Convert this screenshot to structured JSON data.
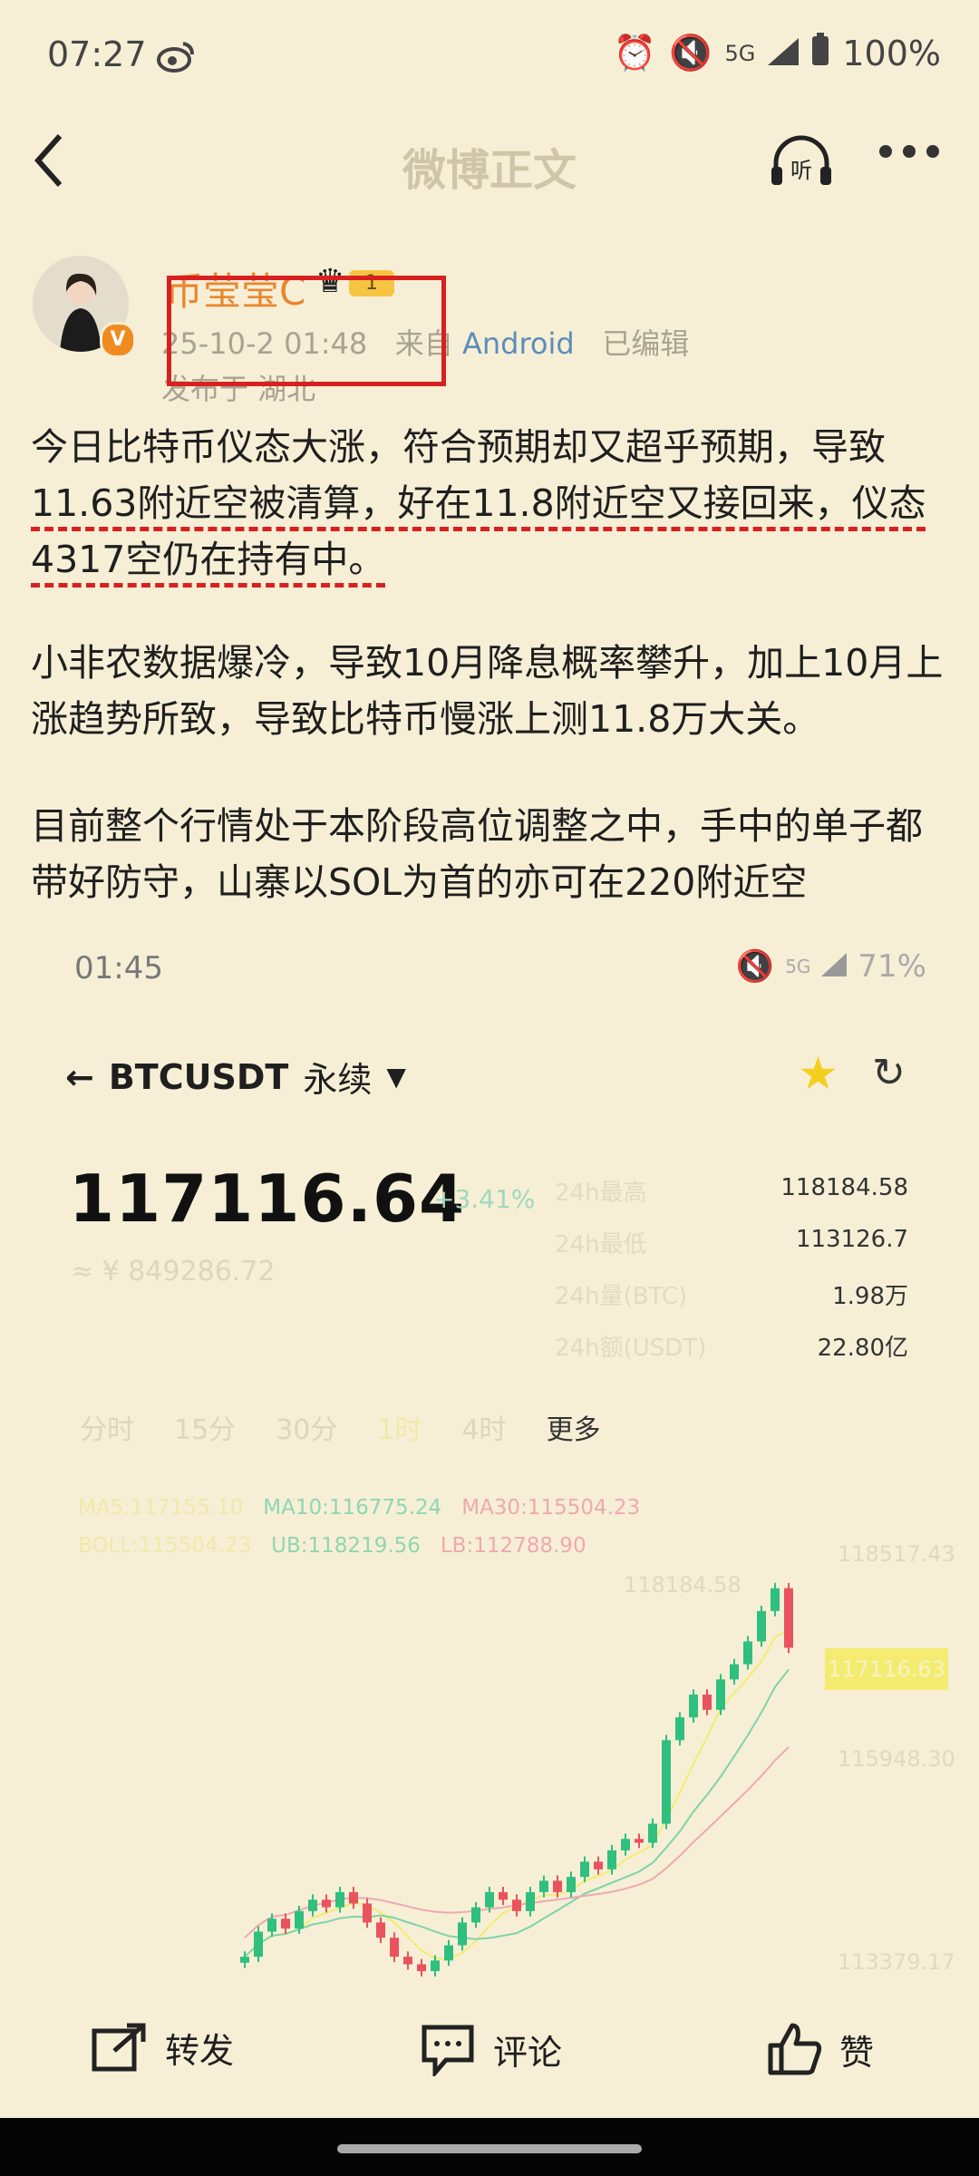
{
  "status_bar": {
    "time": "07:27",
    "network": "5G",
    "battery": "100%"
  },
  "header": {
    "title": "微博正文",
    "listen_label": "听"
  },
  "author": {
    "name": "币莹莹C",
    "level": "1",
    "verified_mark": "V",
    "date": "25-10-2 01:48",
    "source_prefix": "来自",
    "source": "Android",
    "edited": "已编辑",
    "location": "发布于 湖北"
  },
  "post": {
    "p1_a": "今日比特币仪态大涨，符合预期却又超乎预期，导致",
    "p1_b": "11.63附近空被清算，好在11.8附近空又接回来，仪态",
    "p1_c": "4317空仍在持有中。",
    "p2": "小非农数据爆冷，导致10月降息概率攀升，加上10月上涨趋势所致，导致比特币慢涨上测11.8万大关。",
    "p3": "目前整个行情处于本阶段高位调整之中，手中的单子都带好防守，山寨以SOL为首的亦可在220附近空"
  },
  "embedded": {
    "time": "01:45",
    "network": "5G",
    "battery": "71%",
    "pair": "BTCUSDT",
    "perp": "永续",
    "price": "117116.64",
    "change": "+3.41%",
    "cny": "≈ ¥ 849286.72",
    "stats": [
      {
        "key": "24h最高",
        "value": "118184.58"
      },
      {
        "key": "24h最低",
        "value": "113126.7"
      },
      {
        "key": "24h量(BTC)",
        "value": "1.98万"
      },
      {
        "key": "24h额(USDT)",
        "value": "22.80亿"
      }
    ],
    "tabs": [
      "分时",
      "15分",
      "30分",
      "1时",
      "4时",
      "更多"
    ],
    "ma5": "MA5:117155.10",
    "ma10": "MA10:116775.24",
    "ma30": "MA30:115504.23",
    "boll": "BOLL:115504.23",
    "ub": "UB:118219.56",
    "lb": "LB:112788.90",
    "y_top": "118517.43",
    "y_mid": "115948.30",
    "y_bot": "113379.17",
    "high_label": "118184.58",
    "current_tag": "117116.63",
    "colors": {
      "up": "#2fbf7f",
      "down": "#e8535d",
      "ma5": "#f3ec70",
      "ma10": "#7fd3a8",
      "ma30": "#f0a8b0"
    }
  },
  "chart_data": {
    "type": "candlestick",
    "ylim": [
      112788.9,
      118517.43
    ],
    "closes": [
      113050,
      113380,
      113550,
      113420,
      113650,
      113800,
      113700,
      113900,
      113750,
      113500,
      113300,
      113050,
      112950,
      112860,
      113000,
      113200,
      113500,
      113700,
      113900,
      113800,
      113650,
      113900,
      114050,
      113900,
      114100,
      114300,
      114200,
      114450,
      114600,
      114550,
      114800,
      115900,
      116200,
      116500,
      116300,
      116700,
      116900,
      117200,
      117600,
      117900,
      117116.64
    ]
  },
  "actions": {
    "repost": "转发",
    "comment": "评论",
    "like": "赞"
  }
}
